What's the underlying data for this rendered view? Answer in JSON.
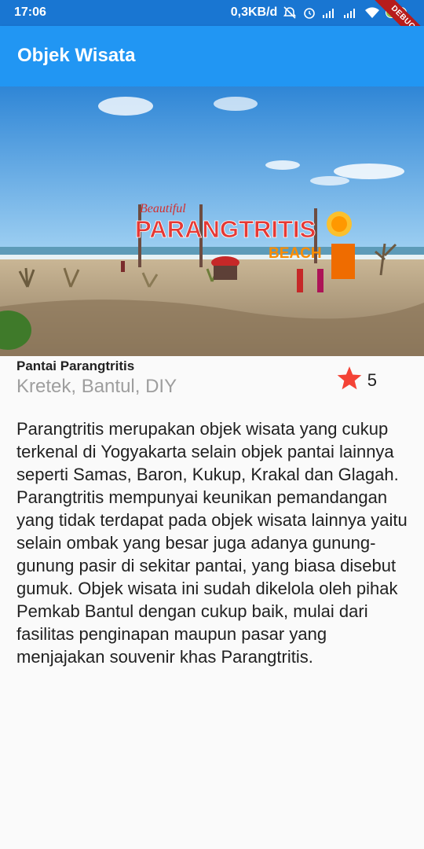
{
  "status": {
    "time": "17:06",
    "network_speed": "0,3KB/d",
    "battery": "100",
    "debug_label": "DEBUG"
  },
  "appbar": {
    "title": "Objek Wisata"
  },
  "hero": {
    "sign_small": "Beautiful",
    "sign_main": "PARANGTRITIS",
    "sign_sub": "BEACH"
  },
  "place": {
    "name": "Pantai Parangtritis",
    "location": "Kretek, Bantul, DIY",
    "rating": "5",
    "description": "Parangtritis merupakan objek wisata yang cukup terkenal di Yogyakarta selain objek pantai lainnya seperti Samas, Baron, Kukup, Krakal dan Glagah. Parangtritis mempunyai keunikan pemandangan yang tidak terdapat pada objek wisata lainnya yaitu selain ombak yang besar juga adanya gunung-gunung pasir di sekitar pantai, yang biasa disebut gumuk. Objek wisata ini sudah dikelola oleh pihak Pemkab Bantul dengan cukup baik, mulai dari fasilitas penginapan maupun pasar yang menjajakan souvenir khas Parangtritis."
  },
  "colors": {
    "status_bar": "#1976d2",
    "app_bar": "#2196f3",
    "star": "#f44336",
    "location_text": "#9e9e9e"
  },
  "icons": [
    "alarm-off-icon",
    "alarm-icon",
    "signal-icon",
    "wifi-icon",
    "battery-icon",
    "star-icon"
  ]
}
